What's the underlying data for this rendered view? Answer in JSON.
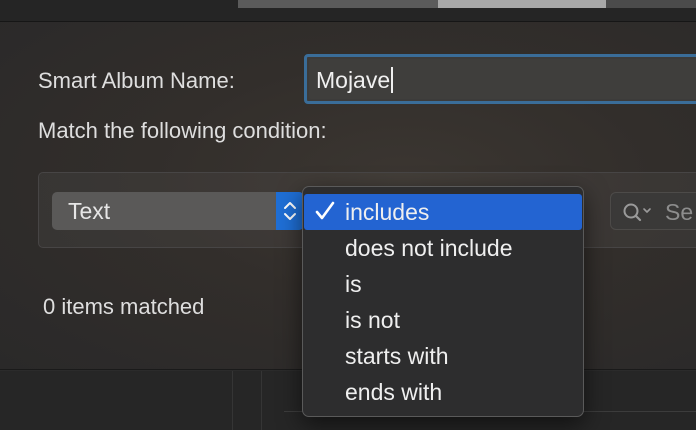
{
  "dialog": {
    "name_label": "Smart Album Name:",
    "name_value": "Mojave",
    "match_label": "Match the following condition:",
    "field_popup": "Text",
    "search_placeholder": "Se",
    "items_matched": "0 items matched"
  },
  "menu": {
    "items": [
      {
        "label": "includes",
        "checked": true
      },
      {
        "label": "does not include",
        "checked": false
      },
      {
        "label": "is",
        "checked": false
      },
      {
        "label": "is not",
        "checked": false
      },
      {
        "label": "starts with",
        "checked": false
      },
      {
        "label": "ends with",
        "checked": false
      }
    ]
  },
  "icons": {
    "popup_arrows": "chevron-up-down-icon",
    "search": "search-icon",
    "check": "checkmark-icon"
  },
  "colors": {
    "accent": "#2364d2",
    "focus_ring": "#3a6d99",
    "menu_bg": "#2d2d2e"
  }
}
